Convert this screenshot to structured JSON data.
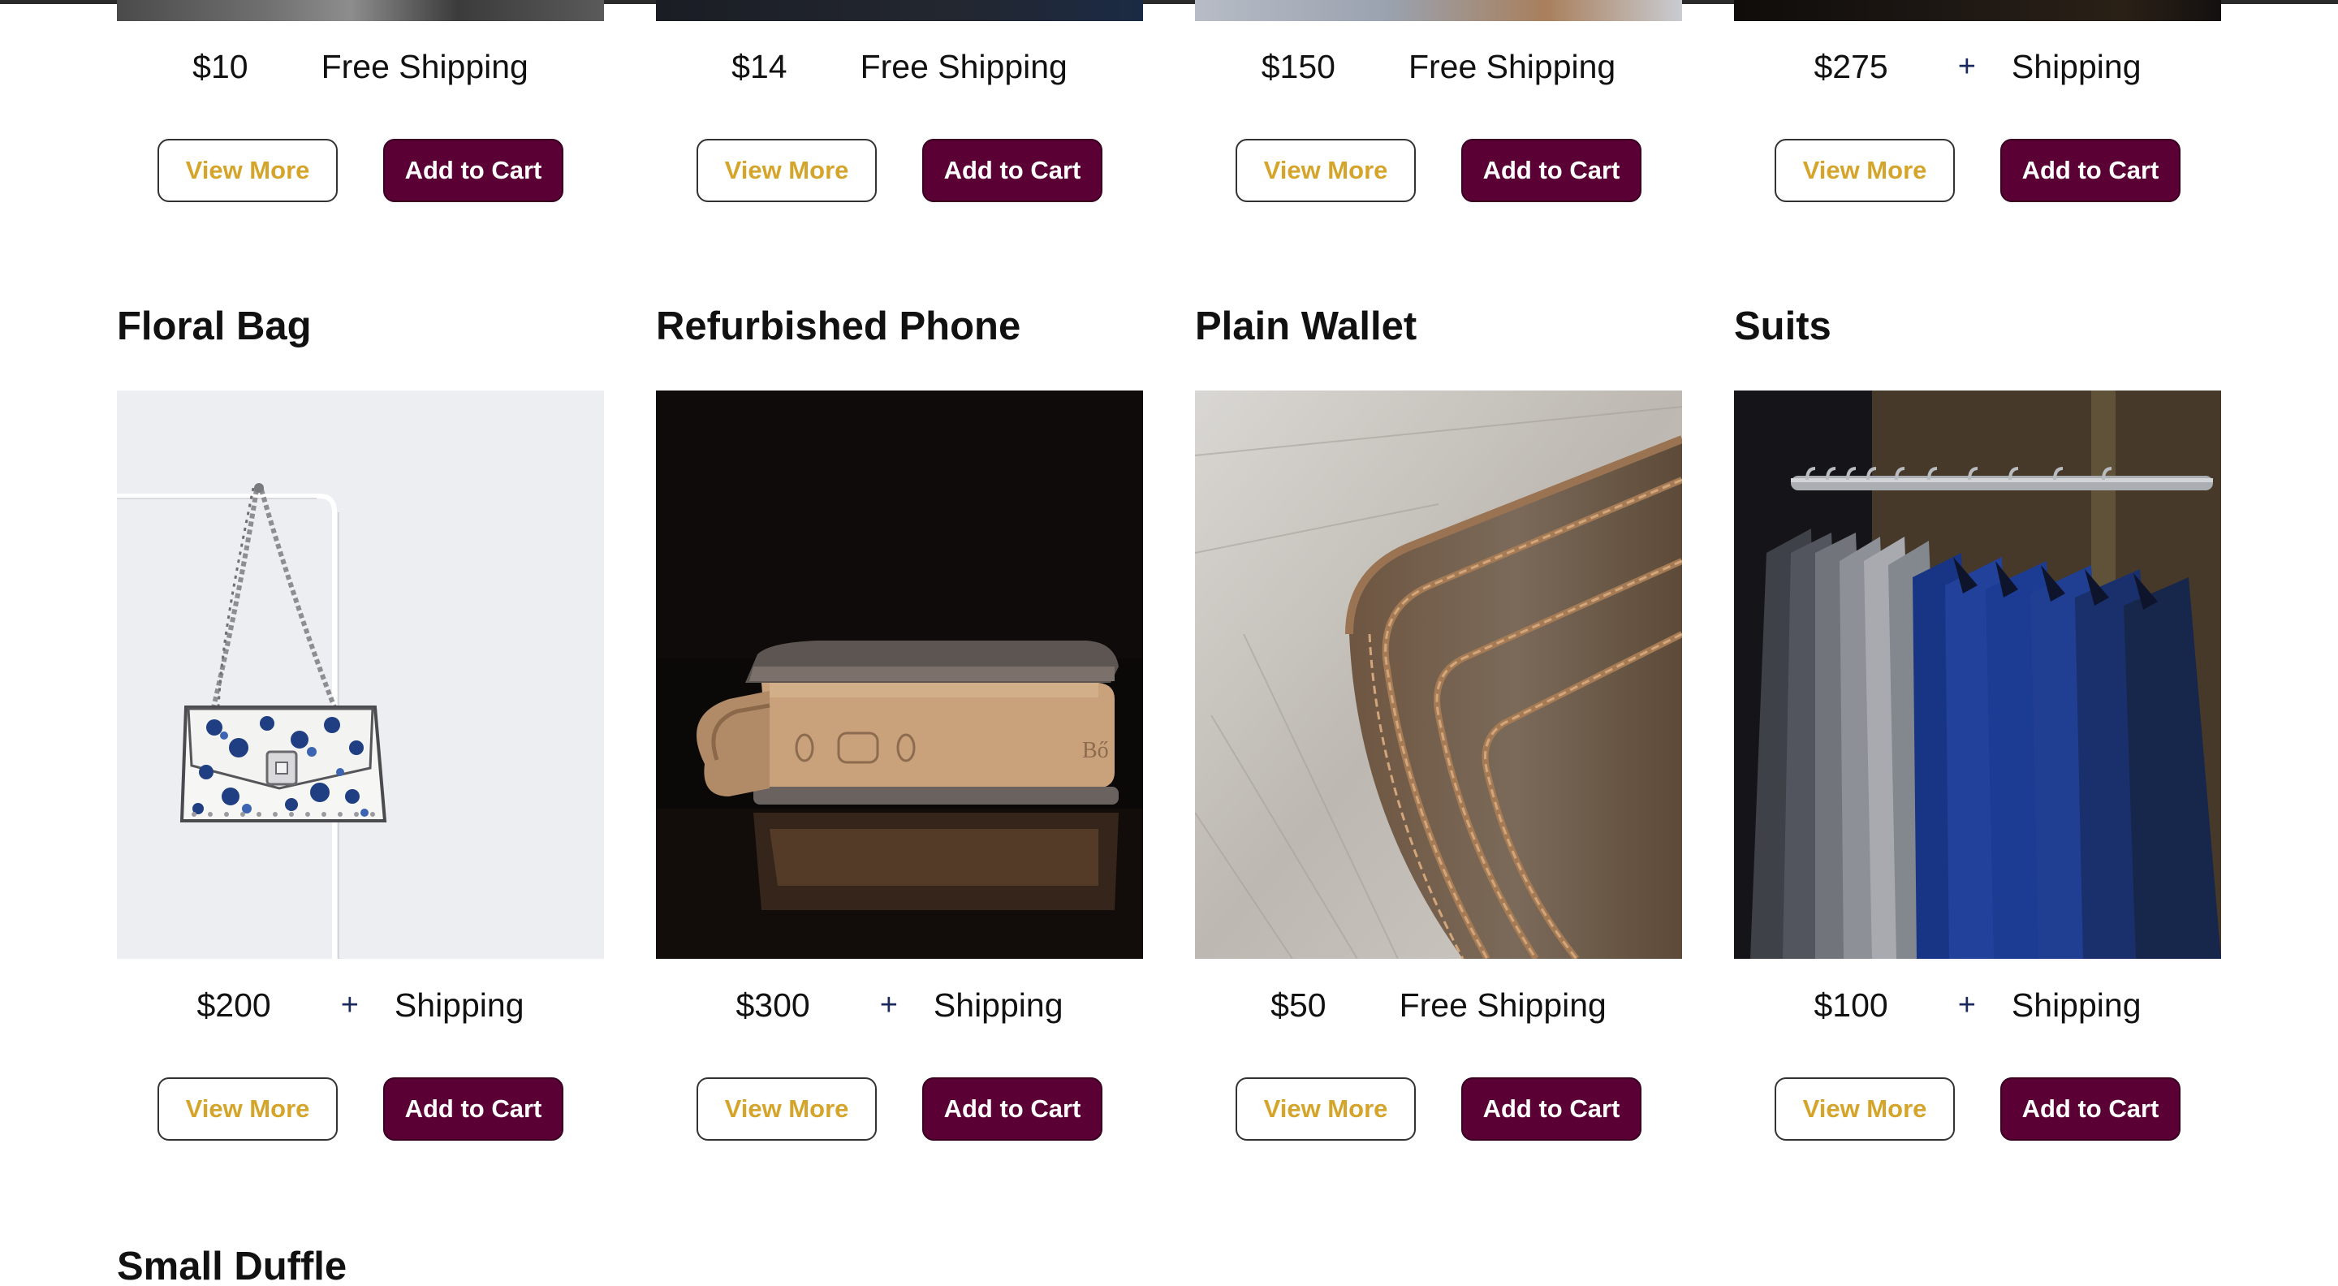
{
  "top_row": [
    {
      "price": "$10",
      "shipping": "Free Shipping",
      "plus": "",
      "view_more": "View More",
      "add_to_cart": "Add to Cart"
    },
    {
      "price": "$14",
      "shipping": "Free Shipping",
      "plus": "",
      "view_more": "View More",
      "add_to_cart": "Add to Cart"
    },
    {
      "price": "$150",
      "shipping": "Free Shipping",
      "plus": "",
      "view_more": "View More",
      "add_to_cart": "Add to Cart"
    },
    {
      "price": "$275",
      "shipping": "Shipping",
      "plus": "+",
      "view_more": "View More",
      "add_to_cart": "Add to Cart"
    }
  ],
  "products": [
    {
      "title": "Floral Bag",
      "price": "$200",
      "plus": "+",
      "shipping": "Shipping",
      "view_more": "View More",
      "add_to_cart": "Add to Cart"
    },
    {
      "title": "Refurbished Phone",
      "price": "$300",
      "plus": "+",
      "shipping": "Shipping",
      "view_more": "View More",
      "add_to_cart": "Add to Cart"
    },
    {
      "title": "Plain Wallet",
      "price": "$50",
      "plus": "",
      "shipping": "Free Shipping",
      "view_more": "View More",
      "add_to_cart": "Add to Cart"
    },
    {
      "title": "Suits",
      "price": "$100",
      "plus": "+",
      "shipping": "Shipping",
      "view_more": "View More",
      "add_to_cart": "Add to Cart"
    }
  ],
  "next_product": {
    "title": "Small Duffle"
  },
  "colors": {
    "view_more_text": "#d4a52a",
    "cart_bg": "#5a0035",
    "plus": "#1b2a5c"
  }
}
